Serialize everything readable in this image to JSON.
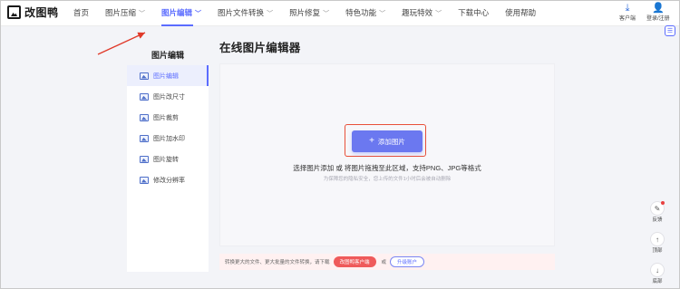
{
  "header": {
    "logo_text": "改图鸭",
    "nav": [
      {
        "label": "首页",
        "has_dropdown": false,
        "active": false
      },
      {
        "label": "图片压缩",
        "has_dropdown": true,
        "active": false
      },
      {
        "label": "图片编辑",
        "has_dropdown": true,
        "active": true
      },
      {
        "label": "图片文件转换",
        "has_dropdown": true,
        "active": false
      },
      {
        "label": "照片修复",
        "has_dropdown": true,
        "active": false
      },
      {
        "label": "特色功能",
        "has_dropdown": true,
        "active": false
      },
      {
        "label": "趣玩特效",
        "has_dropdown": true,
        "active": false
      },
      {
        "label": "下载中心",
        "has_dropdown": false,
        "active": false
      },
      {
        "label": "使用帮助",
        "has_dropdown": false,
        "active": false
      }
    ],
    "client_label": "客户端",
    "login_label": "登录/注册"
  },
  "sidebar": {
    "title": "图片编辑",
    "items": [
      {
        "label": "图片编辑",
        "active": true
      },
      {
        "label": "图片改尺寸",
        "active": false
      },
      {
        "label": "图片裁剪",
        "active": false
      },
      {
        "label": "图片加水印",
        "active": false
      },
      {
        "label": "图片旋转",
        "active": false
      },
      {
        "label": "修改分辨率",
        "active": false
      }
    ]
  },
  "main": {
    "title": "在线图片编辑器",
    "add_button": "添加图片",
    "hint": "选择图片添加 或 将图片拖拽至此区域，支持PNG、JPG等格式",
    "subhint": "为保障您的隐私安全，您上传的文件1小时后会被自动删除"
  },
  "bottom_bar": {
    "text": "转换更大的文件、更大批量的文件转换，请下载",
    "client_button": "改图鸭客户端",
    "or_text": "或",
    "upgrade_button": "升级账户"
  },
  "floating": {
    "feedback_label": "反馈",
    "top_label": "顶部",
    "bottom_label": "底部"
  },
  "colors": {
    "accent": "#5b6cff",
    "highlight_border": "#e8503a",
    "annotation_arrow": "#e03a2a"
  }
}
